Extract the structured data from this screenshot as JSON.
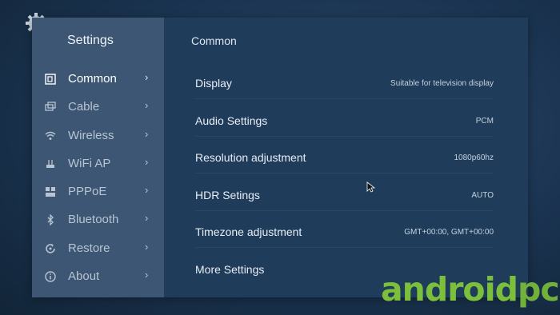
{
  "sidebar": {
    "title": "Settings",
    "items": [
      {
        "label": "Common",
        "icon": "common-icon",
        "active": true
      },
      {
        "label": "Cable",
        "icon": "cable-icon",
        "active": false
      },
      {
        "label": "Wireless",
        "icon": "wifi-icon",
        "active": false
      },
      {
        "label": "WiFi AP",
        "icon": "wifi-ap-icon",
        "active": false
      },
      {
        "label": "PPPoE",
        "icon": "pppoe-icon",
        "active": false
      },
      {
        "label": "Bluetooth",
        "icon": "bluetooth-icon",
        "active": false
      },
      {
        "label": "Restore",
        "icon": "restore-icon",
        "active": false
      },
      {
        "label": "About",
        "icon": "about-icon",
        "active": false
      }
    ],
    "chevron": "›"
  },
  "main": {
    "title": "Common",
    "rows": [
      {
        "label": "Display",
        "value": "Suitable for television display"
      },
      {
        "label": "Audio Settings",
        "value": "PCM"
      },
      {
        "label": "Resolution adjustment",
        "value": "1080p60hz"
      },
      {
        "label": "HDR Setings",
        "value": "AUTO"
      },
      {
        "label": "Timezone adjustment",
        "value": "GMT+00:00, GMT+00:00"
      },
      {
        "label": "More Settings",
        "value": ""
      }
    ]
  },
  "watermark": {
    "brand": "android",
    "suffix": "pc"
  },
  "colors": {
    "sidebar": "#3c5673",
    "main": "#1f3c5b",
    "accent": "#7bbf3a"
  }
}
